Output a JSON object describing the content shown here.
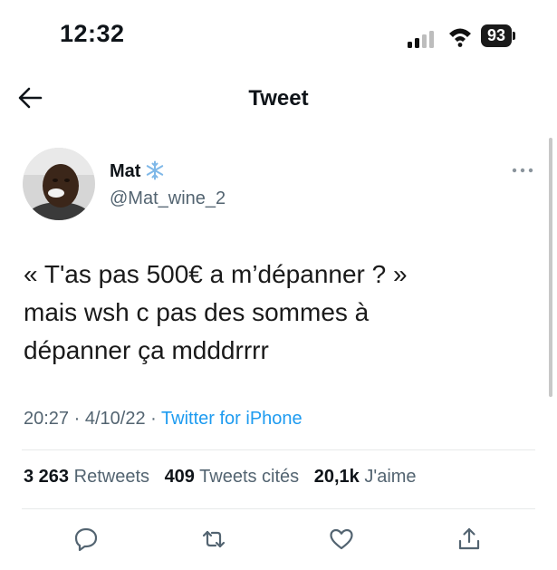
{
  "status_bar": {
    "time": "12:32",
    "battery": "93"
  },
  "header": {
    "title": "Tweet"
  },
  "tweet": {
    "author_name": "Mat",
    "author_handle": "@Mat_wine_2",
    "text_lines": [
      "« T'as pas 500€ a m’dépanner ? »",
      "mais wsh c pas des sommes à",
      "dépanner ça mdddrrrr"
    ],
    "time": "20:27",
    "date": "4/10/22",
    "separator": "·",
    "source": "Twitter for iPhone"
  },
  "stats": [
    {
      "count": "3 263",
      "label": "Retweets"
    },
    {
      "count": "409",
      "label": "Tweets cités"
    },
    {
      "count": "20,1k",
      "label": "J'aime"
    }
  ],
  "colors": {
    "link": "#1d9bf0",
    "secondary_text": "#536471",
    "icon": "#536471"
  },
  "icons": {
    "back": "arrow-left-icon",
    "more": "more-horizontal-icon",
    "badge": "snowflake-icon",
    "actions": [
      "reply-icon",
      "retweet-icon",
      "like-icon",
      "share-icon"
    ]
  }
}
